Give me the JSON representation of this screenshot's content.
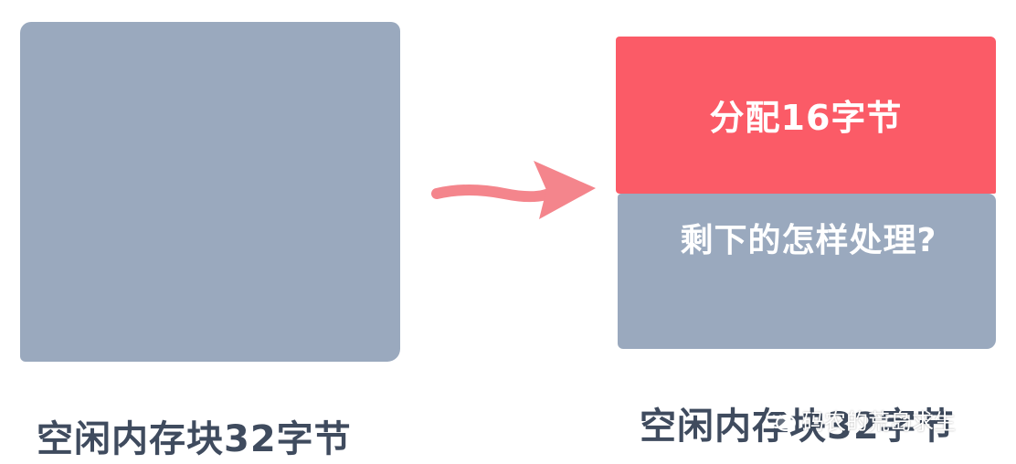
{
  "left": {
    "caption": "空闲内存块32字节",
    "block_color": "#9aa9be"
  },
  "right": {
    "allocated_label": "分配16字节",
    "allocated_color": "#fb5b67",
    "remaining_label": "剩下的怎样处理?",
    "remaining_color": "#9aa9be",
    "caption": "空闲内存块32字节"
  },
  "arrow": {
    "icon": "arrow-right-icon",
    "color": "#f4858c"
  },
  "watermark": {
    "icon": "wechat-icon",
    "text": "码农的荒岛求生"
  }
}
